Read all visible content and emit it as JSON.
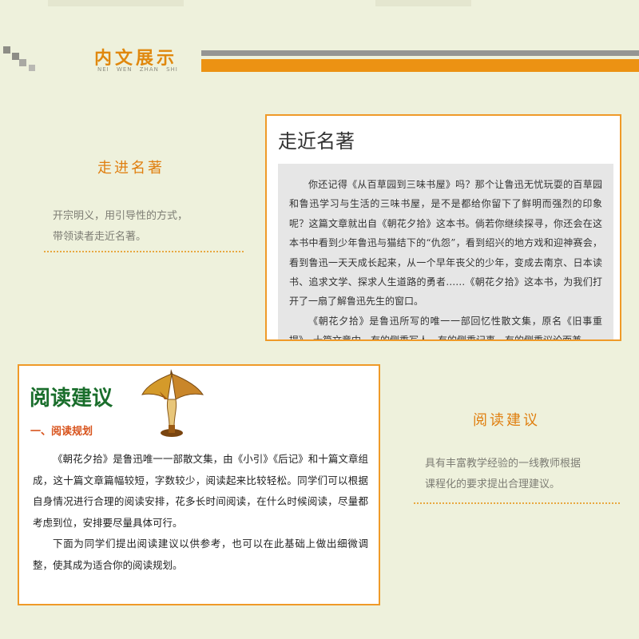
{
  "header": {
    "title": "内文展示",
    "pinyin": "NEI   WEN   ZHAN   SHI"
  },
  "section1": {
    "side_title": "走进名著",
    "side_desc_lines": [
      "开宗明义，用引导性的方式，",
      "带领读者走近名著。"
    ],
    "panel_title": "走近名著",
    "paragraphs": [
      "你还记得《从百草园到三味书屋》吗？那个让鲁迅无忧玩耍的百草园和鲁迅学习与生活的三味书屋，是不是都给你留下了鲜明而强烈的印象呢？这篇文章就出自《朝花夕拾》这本书。倘若你继续探寻，你还会在这本书中看到少年鲁迅与猫结下的“仇怨”，看到绍兴的地方戏和迎神赛会，看到鲁迅一天天成长起来，从一个早年丧父的少年，变成去南京、日本读书、追求文学、探求人生道路的勇者……《朝花夕拾》这本书，为我们打开了一扇了解鲁迅先生的窗口。",
      "《朝花夕拾》是鲁迅所写的唯一一部回忆性散文集，原名《旧事重提》，十篇文章中，有的侧重写人，有的侧重记事，有的侧重议论而兼"
    ]
  },
  "section2": {
    "panel_title": "阅读建议",
    "subtitle": "一、阅读规划",
    "paragraphs": [
      "《朝花夕拾》是鲁迅唯一一部散文集，由《小引》《后记》和十篇文章组成，这十篇文章篇幅较短，字数较少，阅读起来比较轻松。同学们可以根据自身情况进行合理的阅读安排，花多长时间阅读，在什么时候阅读，尽量都考虑到位，安排要尽量具体可行。",
      "下面为同学们提出阅读建议以供参考，也可以在此基础上做出细微调整，使其成为适合你的阅读规划。"
    ],
    "side_title": "阅读建议",
    "side_desc_lines": [
      "具有丰富教学经验的一线教师根据",
      "课程化的要求提出合理建议。"
    ]
  }
}
